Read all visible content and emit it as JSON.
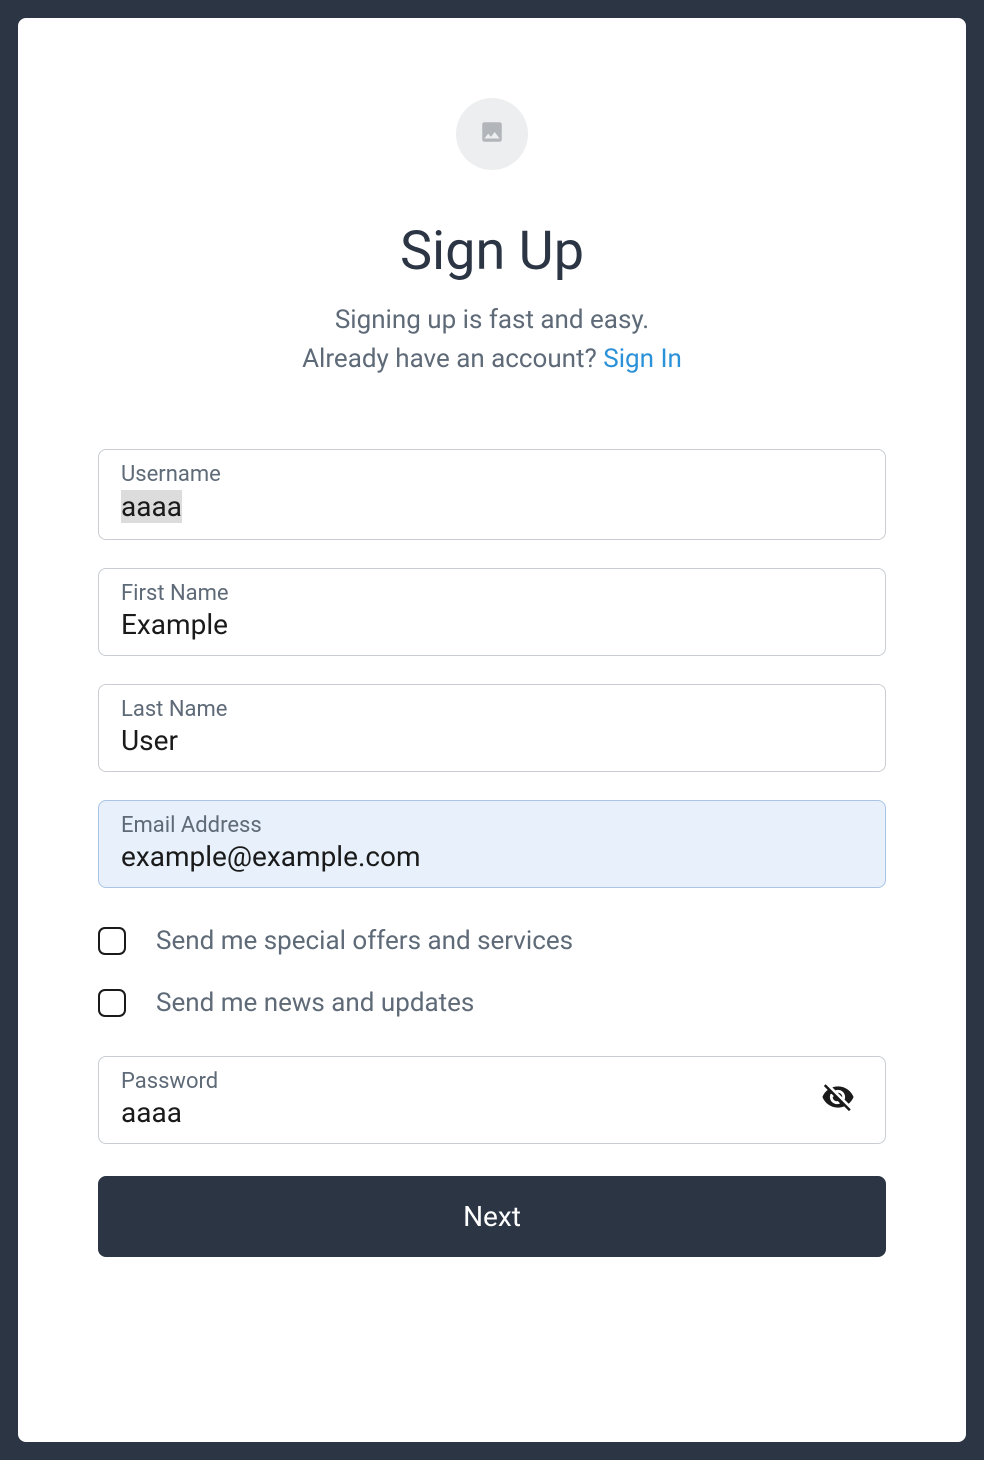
{
  "header": {
    "title": "Sign Up",
    "subtitle": "Signing up is fast and easy.",
    "already_text": "Already have an account? ",
    "signin_link": "Sign In"
  },
  "form": {
    "username": {
      "label": "Username",
      "value": "aaaa"
    },
    "first_name": {
      "label": "First Name",
      "value": "Example"
    },
    "last_name": {
      "label": "Last Name",
      "value": "User"
    },
    "email": {
      "label": "Email Address",
      "value": "example@example.com"
    },
    "offers_checkbox": {
      "label": "Send me special offers and services",
      "checked": false
    },
    "news_checkbox": {
      "label": "Send me news and updates",
      "checked": false
    },
    "password": {
      "label": "Password",
      "value": "aaaa"
    },
    "next_button": "Next"
  }
}
